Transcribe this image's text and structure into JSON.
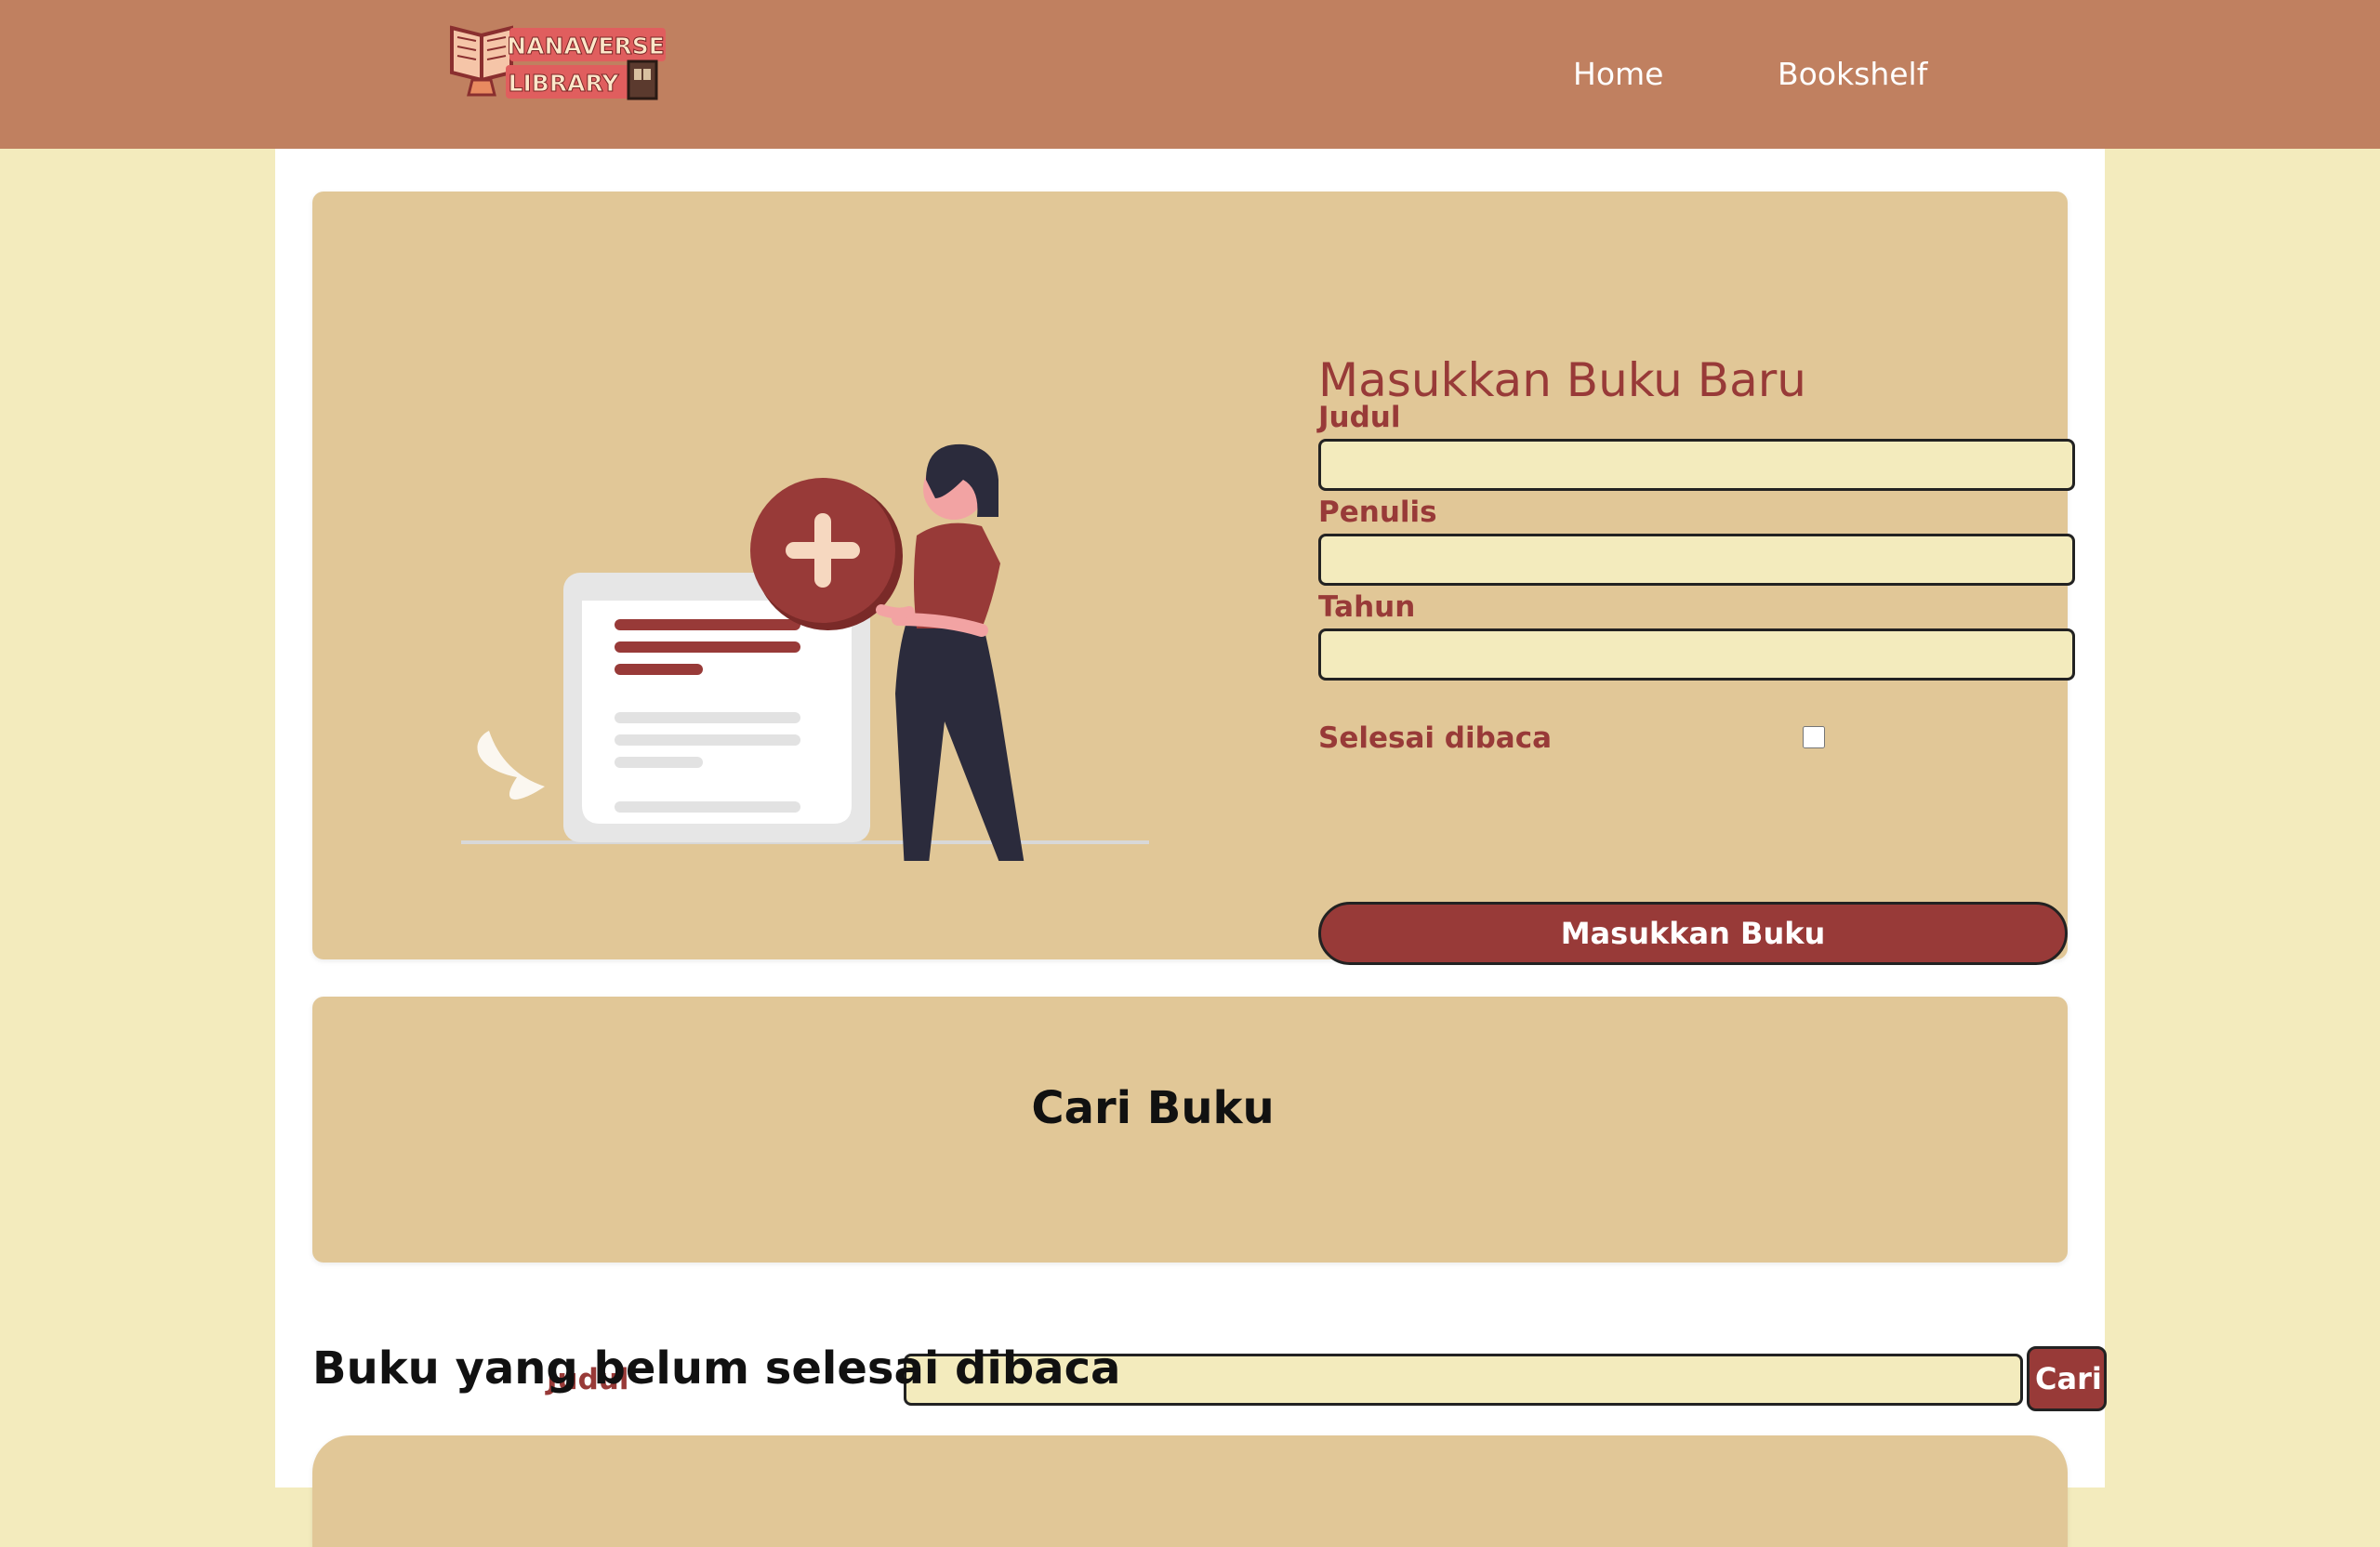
{
  "header": {
    "logo_text_line1": "NANAVERSE",
    "logo_text_line2": "LIBRARY",
    "nav": [
      {
        "label": "Home"
      },
      {
        "label": "Bookshelf"
      }
    ]
  },
  "input_section": {
    "title": "Masukkan Buku Baru",
    "fields": {
      "title_label": "Judul",
      "title_value": "",
      "author_label": "Penulis",
      "author_value": "",
      "year_label": "Tahun",
      "year_value": "",
      "complete_label": "Selesai dibaca",
      "complete_checked": false
    },
    "submit_label": "Masukkan Buku"
  },
  "search_section": {
    "title": "Cari Buku",
    "label": "Judul",
    "value": "",
    "button_label": "Cari"
  },
  "shelf": {
    "incomplete_heading": "Buku yang belum selesai dibaca"
  },
  "colors": {
    "header_bg": "#c08060",
    "page_bg": "#f3ebbd",
    "card_bg": "#e1c797",
    "accent": "#983a38",
    "input_bg": "#f3ebbd"
  }
}
